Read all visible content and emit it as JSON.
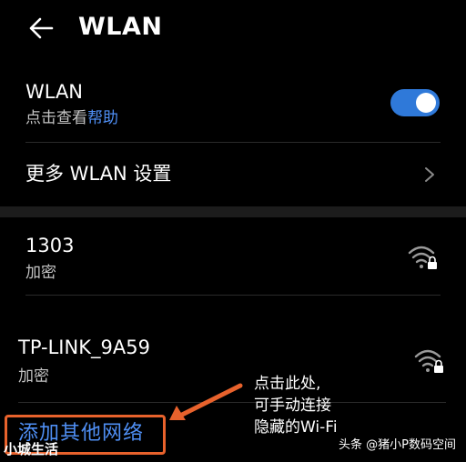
{
  "header": {
    "title": "WLAN"
  },
  "wlan": {
    "label": "WLAN",
    "sub_prefix": "点击查看",
    "help_link": "帮助",
    "enabled": true
  },
  "more_settings": {
    "label": "更多 WLAN 设置"
  },
  "networks": [
    {
      "name": "1303",
      "security": "加密"
    },
    {
      "name": "TP-LINK_9A59",
      "security": "加密"
    }
  ],
  "add_network": {
    "label": "添加其他网络"
  },
  "annotation": {
    "line1": "点击此处,",
    "line2": "可手动连接",
    "line3": "隐藏的Wi-Fi"
  },
  "watermarks": {
    "left": "小城生活",
    "right": "头条 @猪小P数码空间"
  },
  "colors": {
    "accent": "#2f79d9",
    "link": "#4f8ff5",
    "highlight": "#e8622c"
  },
  "icons": {
    "back": "arrow-left-icon",
    "chevron": "chevron-right-icon",
    "wifi": "wifi-lock-icon"
  }
}
